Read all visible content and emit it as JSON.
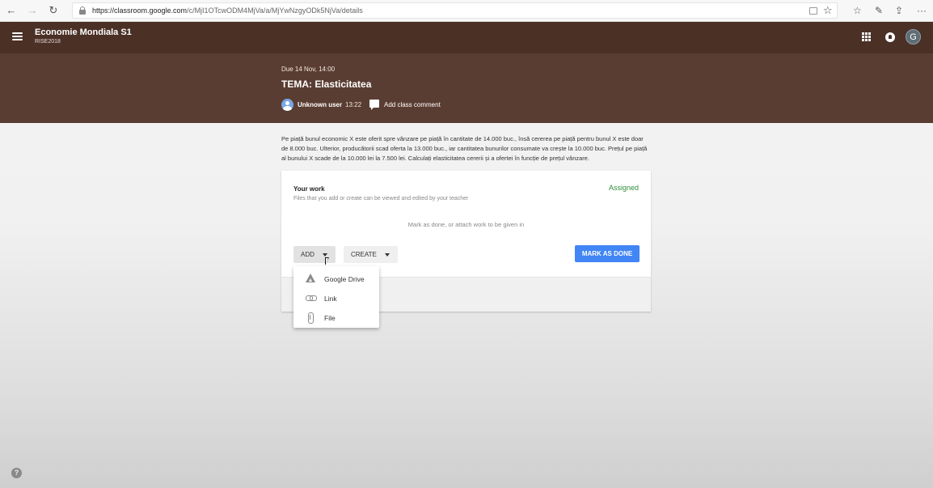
{
  "browser": {
    "back": "←",
    "forward": "→",
    "reload": "↻",
    "url_host": "https://classroom.google.com",
    "url_path": "/c/MjI1OTcwODM4MjVa/a/MjYwNzgyODk5NjVa/details",
    "star": "☆",
    "favorites": "☆",
    "notes": "✎",
    "share": "⇪",
    "more": "···"
  },
  "header": {
    "class_name": "Economie Mondiala S1",
    "section": "RISE2018",
    "avatar_letter": "G"
  },
  "assignment": {
    "due": "Due 14 Nov, 14:00",
    "title": "TEMA: Elasticitatea",
    "author": "Unknown user",
    "time": "13:22",
    "comment_label": "Add class comment",
    "description": "Pe piață bunul economic X este oferit spre vânzare pe piață în cantitate de 14.000 buc., însă cererea pe piață pentru bunul X este doar de 8.000 buc. Ulterior, producătorii scad oferta la 13.000 buc., iar cantitatea bunurilor consumate va crește la 10.000 buc. Prețul pe piață al bunului X scade de la 10.000 lei la 7.500 lei. Calculați elasticitatea cererii și a ofertei în funcție de prețul vânzare."
  },
  "work": {
    "title": "Your work",
    "subtitle": "Files that you add or create can be viewed and edited by your teacher",
    "status": "Assigned",
    "hint": "Mark as done, or attach work to be given in",
    "add_label": "ADD",
    "create_label": "CREATE",
    "done_label": "MARK AS DONE"
  },
  "add_menu": {
    "items": [
      {
        "label": "Google Drive",
        "icon": "google-drive-icon"
      },
      {
        "label": "Link",
        "icon": "link-icon"
      },
      {
        "label": "File",
        "icon": "attachment-icon"
      }
    ]
  },
  "help": "?",
  "colors": {
    "header": "#4b3026",
    "banner": "#5a3d32",
    "status": "#2f8f3a",
    "primary_button": "#4285f4"
  }
}
